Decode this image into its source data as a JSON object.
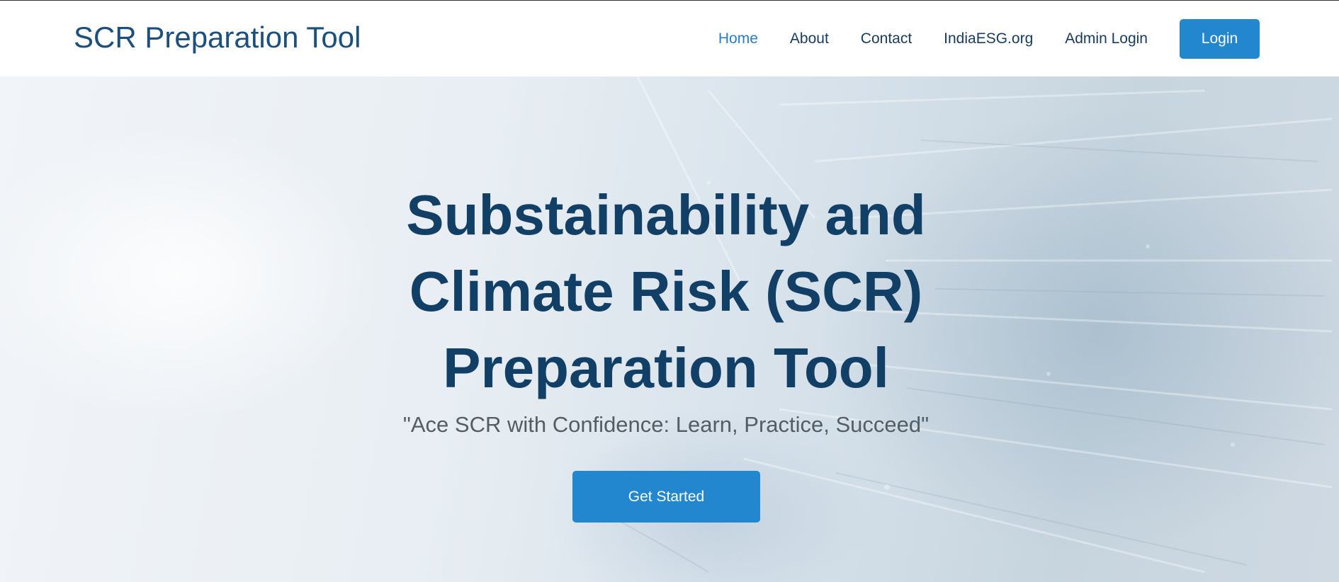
{
  "navbar": {
    "brand": "SCR Preparation Tool",
    "links": [
      {
        "label": "Home",
        "active": true
      },
      {
        "label": "About"
      },
      {
        "label": "Contact"
      },
      {
        "label": "IndiaESG.org"
      },
      {
        "label": "Admin Login"
      }
    ],
    "login_label": "Login"
  },
  "hero": {
    "title": "Substainability and Climate Risk (SCR) Preparation Tool",
    "subtitle": "\"Ace SCR with Confidence: Learn, Practice, Succeed\"",
    "cta_label": "Get Started"
  },
  "colors": {
    "brand": "#1b4f7e",
    "active_link": "#2a7dc0",
    "button": "#2387d0",
    "title": "#123f66"
  }
}
